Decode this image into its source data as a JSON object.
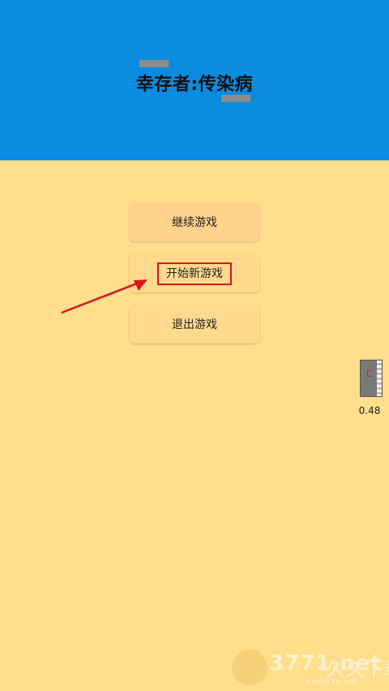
{
  "header": {
    "title": "幸存者:传染病",
    "background_color": "#0A8CE1"
  },
  "menu": {
    "background_color": "#FFDE8C",
    "buttons": [
      {
        "label": "继续游戏"
      },
      {
        "label": "开始新游戏"
      },
      {
        "label": "退出游戏"
      }
    ],
    "highlight_color": "#D8141C"
  },
  "side_widget": {
    "value": "0.48"
  },
  "watermark": {
    "brand": "3771.net",
    "cn": "久久下载",
    "url": "www.kkx.net"
  }
}
